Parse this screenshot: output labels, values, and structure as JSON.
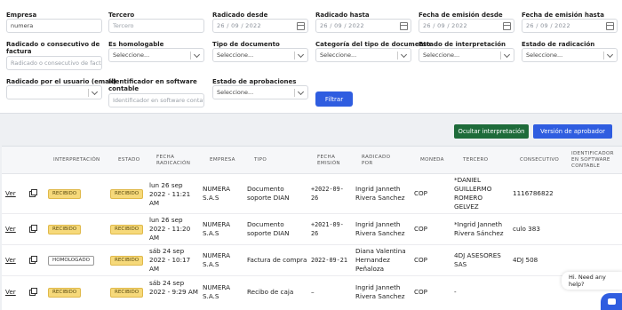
{
  "filters": {
    "empresa": {
      "label": "Empresa",
      "value": "numera"
    },
    "tercero": {
      "label": "Tercero",
      "placeholder": "Tercero"
    },
    "radicado_desde": {
      "label": "Radicado desde",
      "value": "26 / 09 / 2022"
    },
    "radicado_hasta": {
      "label": "Radicado hasta",
      "value": "26 / 09 / 2022"
    },
    "emision_desde": {
      "label": "Fecha de emisión desde",
      "value": "26 / 09 / 2022"
    },
    "emision_hasta": {
      "label": "Fecha de emisión hasta",
      "value": "26 / 09 / 2022"
    },
    "consecutivo": {
      "label": "Radicado o consecutivo de factura",
      "placeholder": "Radicado o consecutivo de factu"
    },
    "homologable": {
      "label": "Es homologable",
      "value": "Seleccione..."
    },
    "tipo_documento": {
      "label": "Tipo de documento",
      "value": "Seleccione..."
    },
    "categoria": {
      "label": "Categoría del tipo de documento",
      "value": "Seleccione..."
    },
    "estado_interpretacion": {
      "label": "Estado de interpretación",
      "value": "Seleccione..."
    },
    "estado_radicacion": {
      "label": "Estado de radicación",
      "value": "Seleccione..."
    },
    "radicado_por": {
      "label": "Radicado por el usuario (email)",
      "value": ""
    },
    "identificador": {
      "label": "Identificador en software contable",
      "placeholder": "Identificador en software contat"
    },
    "estado_aprobaciones": {
      "label": "Estado de aprobaciones",
      "value": "Seleccione..."
    },
    "filtrar_label": "Filtrar"
  },
  "actions": {
    "ocultar_label": "Ocultar interpretación",
    "version_label": "Versión de aprobador"
  },
  "table": {
    "headers": {
      "interpretacion": "INTERPRETACIÓN",
      "estado": "ESTADO",
      "fecha_radicacion": "FECHA RADICACIÓN",
      "empresa": "EMPRESA",
      "tipo": "TIPO",
      "fecha_emision": "FECHA EMISIÓN",
      "radicado_por": "RADICADO POR",
      "moneda": "MONEDA",
      "tercero": "TERCERO",
      "consecutivo": "CONSECUTIVO",
      "identificador": "IDENTIFICADOR EN SOFTWARE CONTABLE"
    },
    "rows": [
      {
        "ver": "Ver",
        "interpretacion": "RECIBIDO",
        "estado": "RECIBIDO",
        "fecha_radicacion": "lun 26 sep 2022 - 11:21 AM",
        "empresa": "NUMERA S.A.S",
        "tipo": "Documento soporte DIAN",
        "fecha_emision": "+2022-09-26",
        "radicado_por": "Ingrid Janneth Rivera Sanchez",
        "moneda": "COP",
        "tercero": "*DANIEL GUILLERMO ROMERO GELVEZ",
        "consecutivo": "1116786822"
      },
      {
        "ver": "Ver",
        "interpretacion": "RECIBIDO",
        "estado": "RECIBIDO",
        "fecha_radicacion": "lun 26 sep 2022 - 11:20 AM",
        "empresa": "NUMERA S.A.S",
        "tipo": "Documento soporte DIAN",
        "fecha_emision": "+2021-09-26",
        "radicado_por": "Ingrid Janneth Rivera Sanchez",
        "moneda": "COP",
        "tercero": "*Ingrid Janneth Rivera Sánchez",
        "consecutivo": "culo 383"
      },
      {
        "ver": "Ver",
        "interpretacion": "HOMOLOGADO",
        "estado": "RECIBIDO",
        "fecha_radicacion": "sáb 24 sep 2022 - 10:17 AM",
        "empresa": "NUMERA S.A.S",
        "tipo": "Factura de compra",
        "fecha_emision": "2022-09-21",
        "radicado_por": "Diana Valentina Hernandez Peñaloza",
        "moneda": "COP",
        "tercero": "4DJ ASESORES SAS",
        "consecutivo": "4DJ 508"
      },
      {
        "ver": "Ver",
        "interpretacion": "RECIBIDO",
        "estado": "RECIBIDO",
        "fecha_radicacion": "sáb 24 sep 2022 - 9:29 AM",
        "empresa": "NUMERA S.A.S",
        "tipo": "Recibo de caja",
        "fecha_emision": "–",
        "radicado_por": "Ingrid Janneth Rivera Sanchez",
        "moneda": "COP",
        "tercero": "-",
        "consecutivo": ""
      }
    ]
  },
  "help": {
    "text": "Hi. Need any help?"
  }
}
